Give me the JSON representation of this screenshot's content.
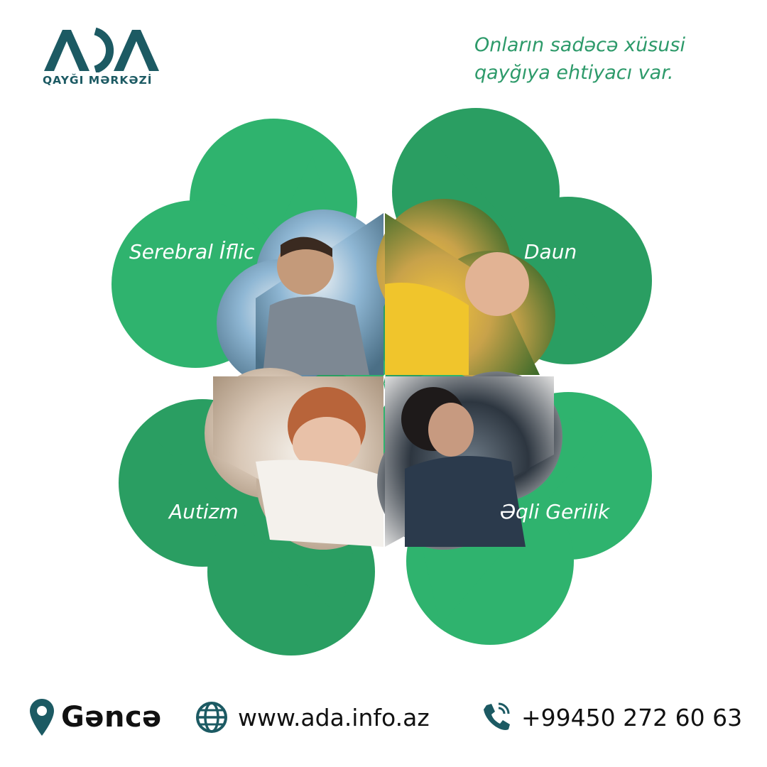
{
  "brand": {
    "logo_text": "ADA",
    "subtitle": "QAYĞI MƏRKƏZİ",
    "color": "#1c5a63"
  },
  "tagline": {
    "line1": "Onların sadəcə xüsusi",
    "line2": "qayğıya ehtiyacı var.",
    "color": "#2d9a6a"
  },
  "clover": {
    "leaf_color_light": "#2fb36e",
    "leaf_color_dark": "#2a9e62",
    "leaves": [
      {
        "label": "Serebral İflic",
        "photo": "child-in-wheelchair-photo"
      },
      {
        "label": "Daun",
        "photo": "child-yellow-shirt-photo"
      },
      {
        "label": "Autizm",
        "photo": "child-covering-eyes-photo"
      },
      {
        "label": "Əqli Gerilik",
        "photo": "boy-with-caregiver-photo"
      }
    ]
  },
  "footer": {
    "city": "Gəncə",
    "website": "www.ada.info.az",
    "phone": "+99450 272 60 63",
    "icons": [
      "location-pin-icon",
      "globe-icon",
      "phone-icon"
    ],
    "icon_color": "#1c5a63"
  }
}
